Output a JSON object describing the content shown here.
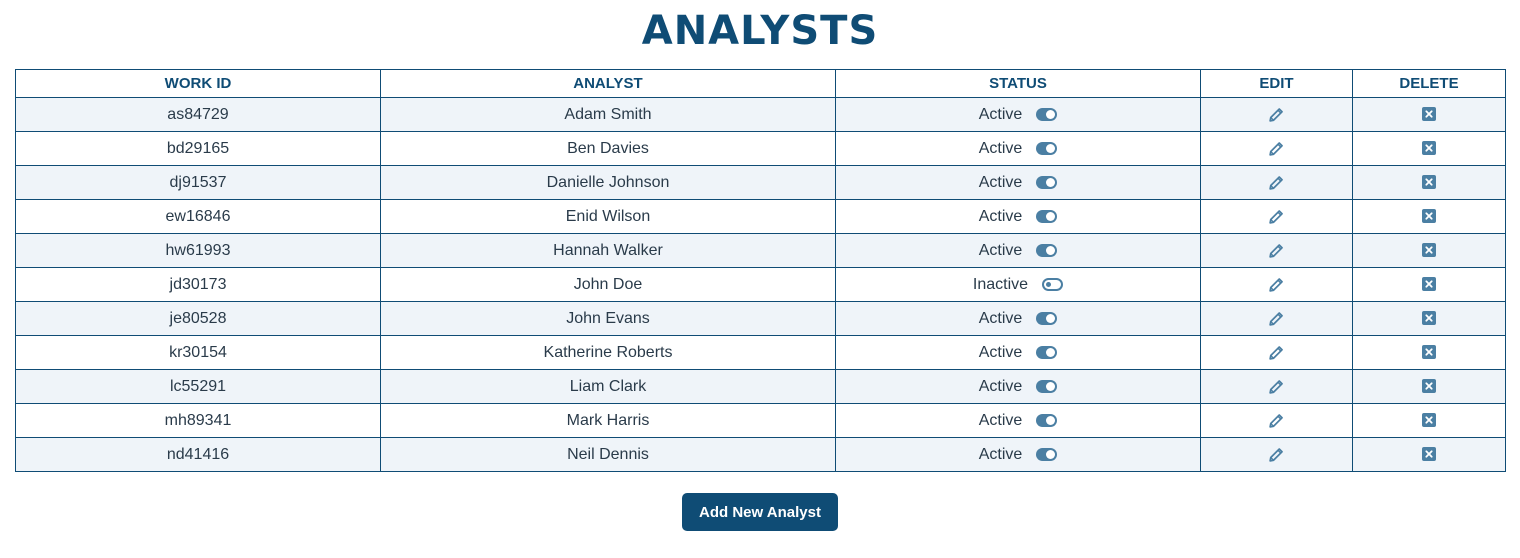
{
  "page": {
    "title": "ANALYSTS"
  },
  "table": {
    "headers": {
      "work_id": "WORK ID",
      "analyst": "ANALYST",
      "status": "STATUS",
      "edit": "EDIT",
      "delete": "DELETE"
    },
    "rows": [
      {
        "work_id": "as84729",
        "analyst": "Adam Smith",
        "status": "Active",
        "active": true
      },
      {
        "work_id": "bd29165",
        "analyst": "Ben Davies",
        "status": "Active",
        "active": true
      },
      {
        "work_id": "dj91537",
        "analyst": "Danielle Johnson",
        "status": "Active",
        "active": true
      },
      {
        "work_id": "ew16846",
        "analyst": "Enid Wilson",
        "status": "Active",
        "active": true
      },
      {
        "work_id": "hw61993",
        "analyst": "Hannah Walker",
        "status": "Active",
        "active": true
      },
      {
        "work_id": "jd30173",
        "analyst": "John Doe",
        "status": "Inactive",
        "active": false
      },
      {
        "work_id": "je80528",
        "analyst": "John Evans",
        "status": "Active",
        "active": true
      },
      {
        "work_id": "kr30154",
        "analyst": "Katherine Roberts",
        "status": "Active",
        "active": true
      },
      {
        "work_id": "lc55291",
        "analyst": "Liam Clark",
        "status": "Active",
        "active": true
      },
      {
        "work_id": "mh89341",
        "analyst": "Mark Harris",
        "status": "Active",
        "active": true
      },
      {
        "work_id": "nd41416",
        "analyst": "Neil Dennis",
        "status": "Active",
        "active": true
      }
    ],
    "icons": {
      "edit": "pencil-icon",
      "delete": "close-box-icon",
      "status_toggle": "toggle-switch"
    }
  },
  "actions": {
    "add_label": "Add New Analyst"
  },
  "colors": {
    "brand": "#0f4c75",
    "accent": "#4b7fa3",
    "row_stripe": "#eff4f9"
  }
}
